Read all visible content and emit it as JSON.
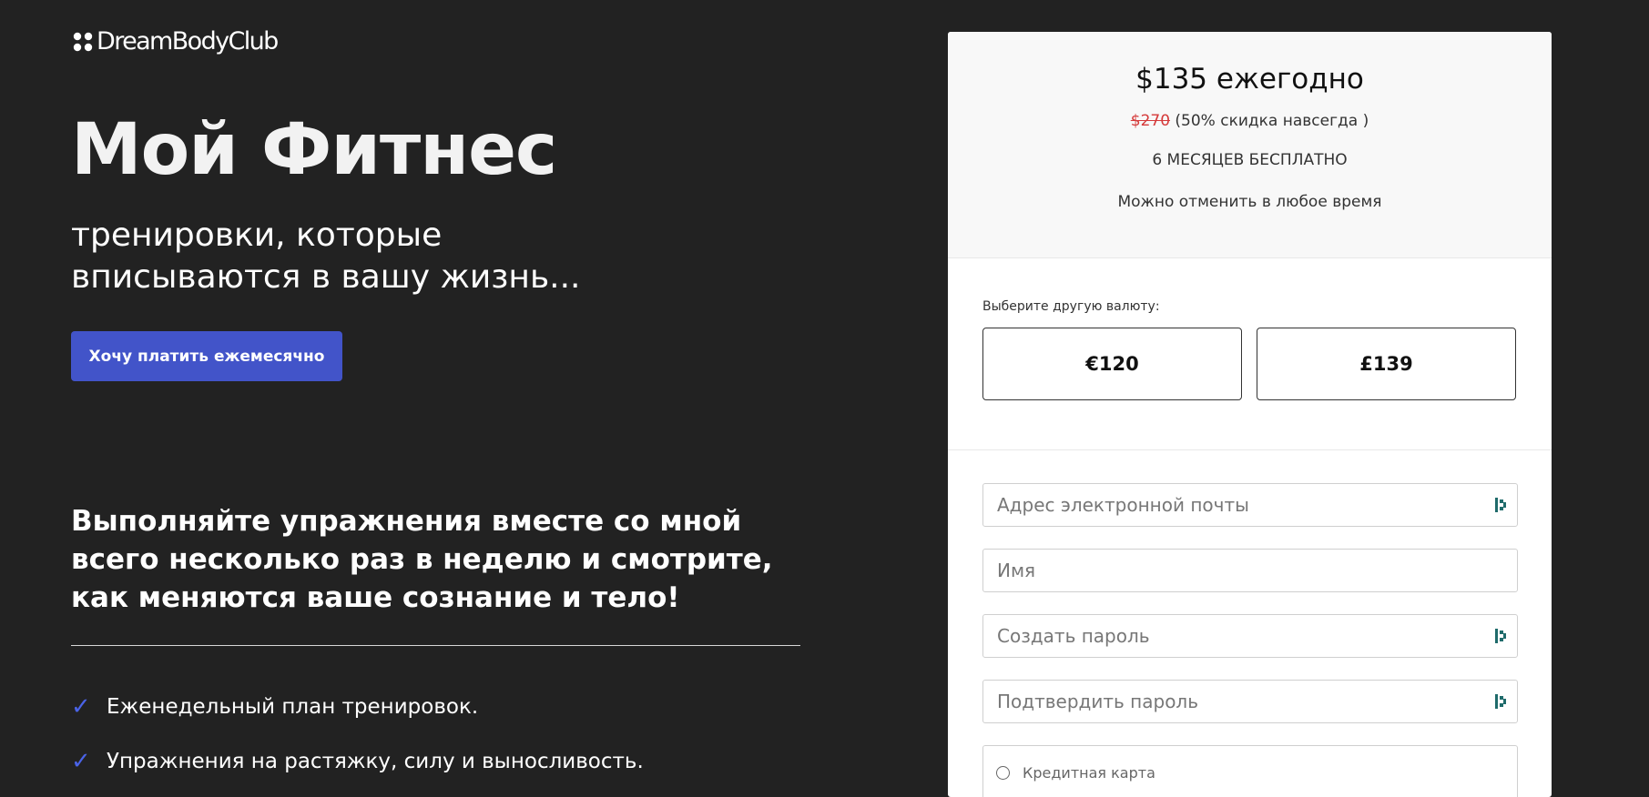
{
  "brand": {
    "name": "DreamBodyClub",
    "icon": "dreambodyclub-logo-icon"
  },
  "hero": {
    "title": "Мой Фитнес",
    "subtitle": "тренировки, которые вписываются в вашу жизнь...",
    "monthly_button": "Хочу платить ежемесячно"
  },
  "promo": {
    "heading": "Выполняйте упражнения вместе со мной всего несколько раз в неделю и смотрите, как меняются ваше сознание и тело!"
  },
  "features": [
    {
      "icon": "checkmark-icon",
      "text": "Еженедельный план тренировок."
    },
    {
      "icon": "checkmark-icon",
      "text": "Упражнения на растяжку, силу и выносливость."
    }
  ],
  "pricing": {
    "price": "$135 ежегодно",
    "old_price": "$270",
    "discount": "(50% скидка навсегда )",
    "free_months": "6 МЕСЯЦЕВ БЕСПЛАТНО",
    "cancel_note": "Можно отменить в любое время"
  },
  "currency": {
    "label": "Выберите другую валюту:",
    "options": [
      "€120",
      "£139"
    ]
  },
  "form": {
    "email_placeholder": "Адрес электронной почты",
    "name_placeholder": "Имя",
    "password_placeholder": "Создать пароль",
    "confirm_password_placeholder": "Подтвердить пароль",
    "field_icon": "password-manager-icon",
    "payment_option": "Кредитная карта"
  },
  "colors": {
    "background": "#222222",
    "accent": "#4254c9",
    "check": "#4a63e7",
    "old_price": "#d53a3a",
    "field_icon": "#1f6b6b"
  }
}
